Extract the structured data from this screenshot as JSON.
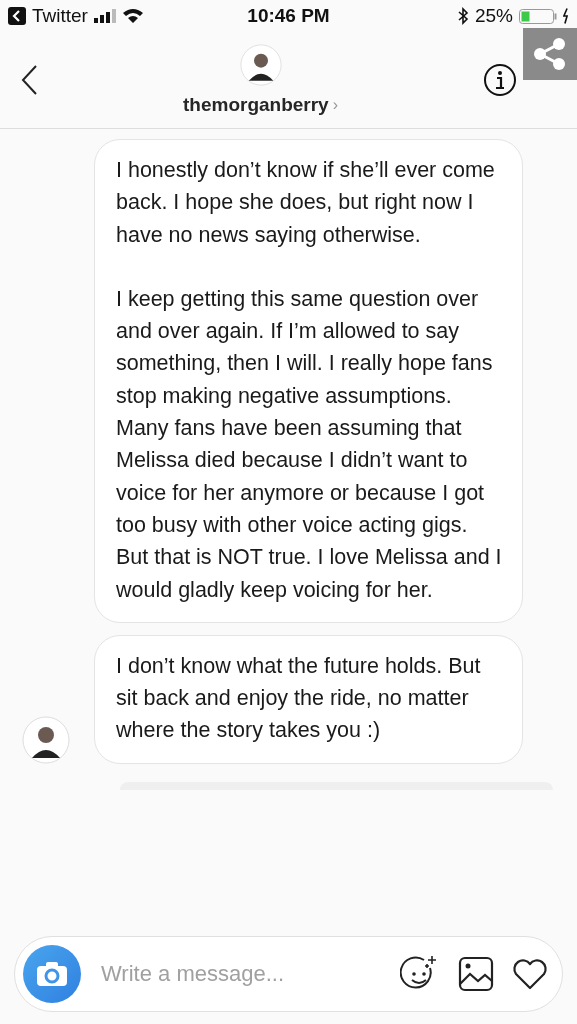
{
  "status_bar": {
    "back_app": "Twitter",
    "time": "10:46 PM",
    "battery": "25%"
  },
  "header": {
    "username": "themorganberry",
    "chevron": "›"
  },
  "messages": [
    {
      "paragraphs": [
        "I honestly don’t know if she’ll ever come back. I hope she does, but right now I have no news saying otherwise.",
        "I keep getting this same question over and over again. If I’m allowed to say something, then I will. I really hope fans stop making negative assumptions. Many fans have been assuming that Melissa died because I didn’t want to voice for her anymore or because I got too busy with other voice acting gigs. But that is NOT true. I love Melissa and I would gladly keep voicing for her."
      ],
      "show_avatar": false
    },
    {
      "paragraphs": [
        "I don’t know what the future holds. But sit back and enjoy the ride, no matter where the story takes you :)"
      ],
      "show_avatar": true
    }
  ],
  "composer": {
    "placeholder": "Write a message..."
  }
}
